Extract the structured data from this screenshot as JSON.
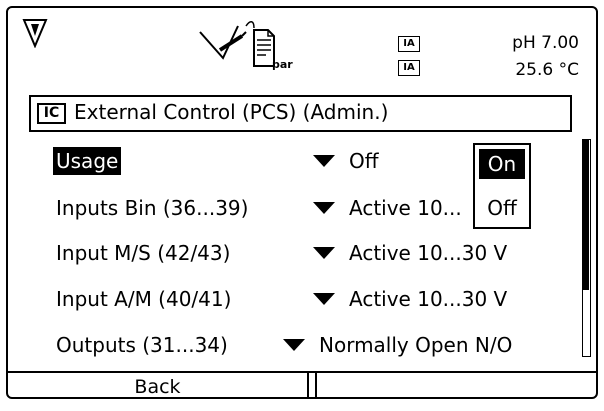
{
  "status": {
    "ia_1": "IA",
    "ia_2": "IA",
    "ph": "pH 7.00",
    "temp": "25.6 °C",
    "icons": [
      "wrench-shield-icon",
      "sensor-probe-icon",
      "parameter-document-icon"
    ],
    "param_doc_label": "par"
  },
  "title": {
    "icon": "IC",
    "text": "External Control (PCS) (Admin.)"
  },
  "rows": [
    {
      "label": "Usage",
      "value": "Off"
    },
    {
      "label": "Inputs Bin (36...39)",
      "value": "Active 10..."
    },
    {
      "label": "Input M/S (42/43)",
      "value": "Active 10...30 V"
    },
    {
      "label": "Input A/M (40/41)",
      "value": "Active 10...30 V"
    },
    {
      "label": "Outputs (31...34)",
      "value": "Normally Open N/O"
    }
  ],
  "popup": {
    "options": [
      "On",
      "Off"
    ],
    "selected": "On"
  },
  "softkeys": {
    "left": "Back",
    "right": ""
  }
}
